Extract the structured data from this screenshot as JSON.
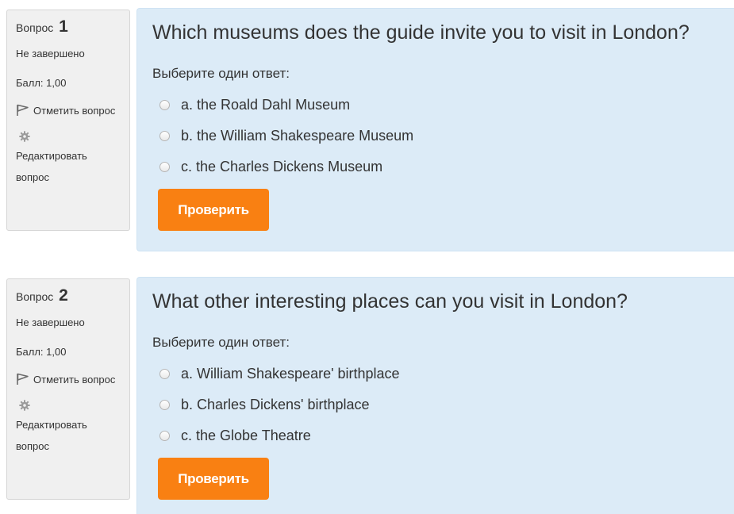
{
  "colors": {
    "info_panel_bg": "#f0f0f0",
    "content_bg": "#dcebf7",
    "button_bg": "#f98012",
    "button_text": "#ffffff"
  },
  "questions": [
    {
      "label": "Вопрос",
      "number": "1",
      "state": "Не завершено",
      "grade": "Балл: 1,00",
      "flag_label": "Отметить вопрос",
      "flag_icon": "flag-icon",
      "edit_label": "Редактировать вопрос",
      "edit_icon": "gear-icon",
      "text": "Which museums does the guide invite you to visit in London?",
      "prompt": "Выберите один ответ:",
      "answers": [
        "a. the Roald Dahl Museum",
        "b. the William Shakespeare Museum",
        "c. the Charles Dickens Museum"
      ],
      "check_label": "Проверить"
    },
    {
      "label": "Вопрос",
      "number": "2",
      "state": "Не завершено",
      "grade": "Балл: 1,00",
      "flag_label": "Отметить вопрос",
      "flag_icon": "flag-icon",
      "edit_label": "Редактировать вопрос",
      "edit_icon": "gear-icon",
      "text": "What other interesting places can you visit in London?",
      "prompt": "Выберите один ответ:",
      "answers": [
        "a. William Shakespeare' birthplace",
        "b. Charles Dickens' birthplace",
        "c. the Globe Theatre"
      ],
      "check_label": "Проверить"
    }
  ]
}
